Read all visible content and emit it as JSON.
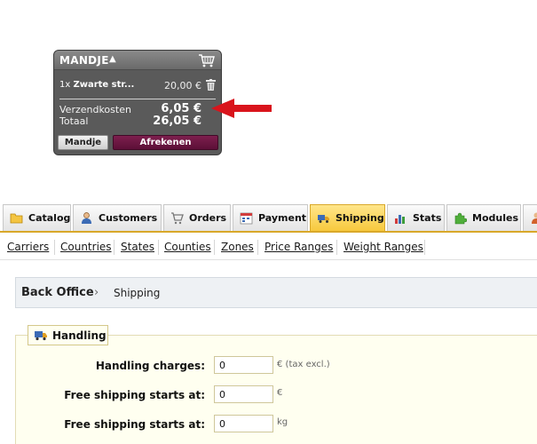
{
  "cart": {
    "title": "MANDJE",
    "caret": "▲",
    "item_qty": "1x",
    "item_name": "Zwarte str...",
    "item_price": "20,00 €",
    "shipping_label": "Verzendkosten",
    "shipping_value": "6,05 €",
    "total_label": "Totaal",
    "total_value": "26,05 €",
    "btn_cart": "Mandje",
    "btn_checkout": "Afrekenen"
  },
  "tabs": [
    {
      "label": "Catalog",
      "icon": "folder-icon"
    },
    {
      "label": "Customers",
      "icon": "user-icon"
    },
    {
      "label": "Orders",
      "icon": "cart-icon"
    },
    {
      "label": "Payment",
      "icon": "calendar-icon"
    },
    {
      "label": "Shipping",
      "icon": "truck-icon",
      "active": true
    },
    {
      "label": "Stats",
      "icon": "bar-chart-icon"
    },
    {
      "label": "Modules",
      "icon": "puzzle-icon"
    }
  ],
  "subnav": [
    "Carriers",
    "Countries",
    "States",
    "Counties",
    "Zones",
    "Price Ranges",
    "Weight Ranges"
  ],
  "breadcrumb": {
    "root": "Back Office",
    "separator": "›",
    "current": "Shipping"
  },
  "handling": {
    "legend": "Handling",
    "rows": [
      {
        "label": "Handling charges:",
        "value": "0",
        "unit": "€ (tax excl.)"
      },
      {
        "label": "Free shipping starts at:",
        "value": "0",
        "unit": "€"
      },
      {
        "label": "Free shipping starts at:",
        "value": "0",
        "unit": "kg"
      }
    ]
  },
  "colors": {
    "accent": "#f7c93d",
    "checkout": "#6b1541",
    "arrow": "#d9141c"
  }
}
